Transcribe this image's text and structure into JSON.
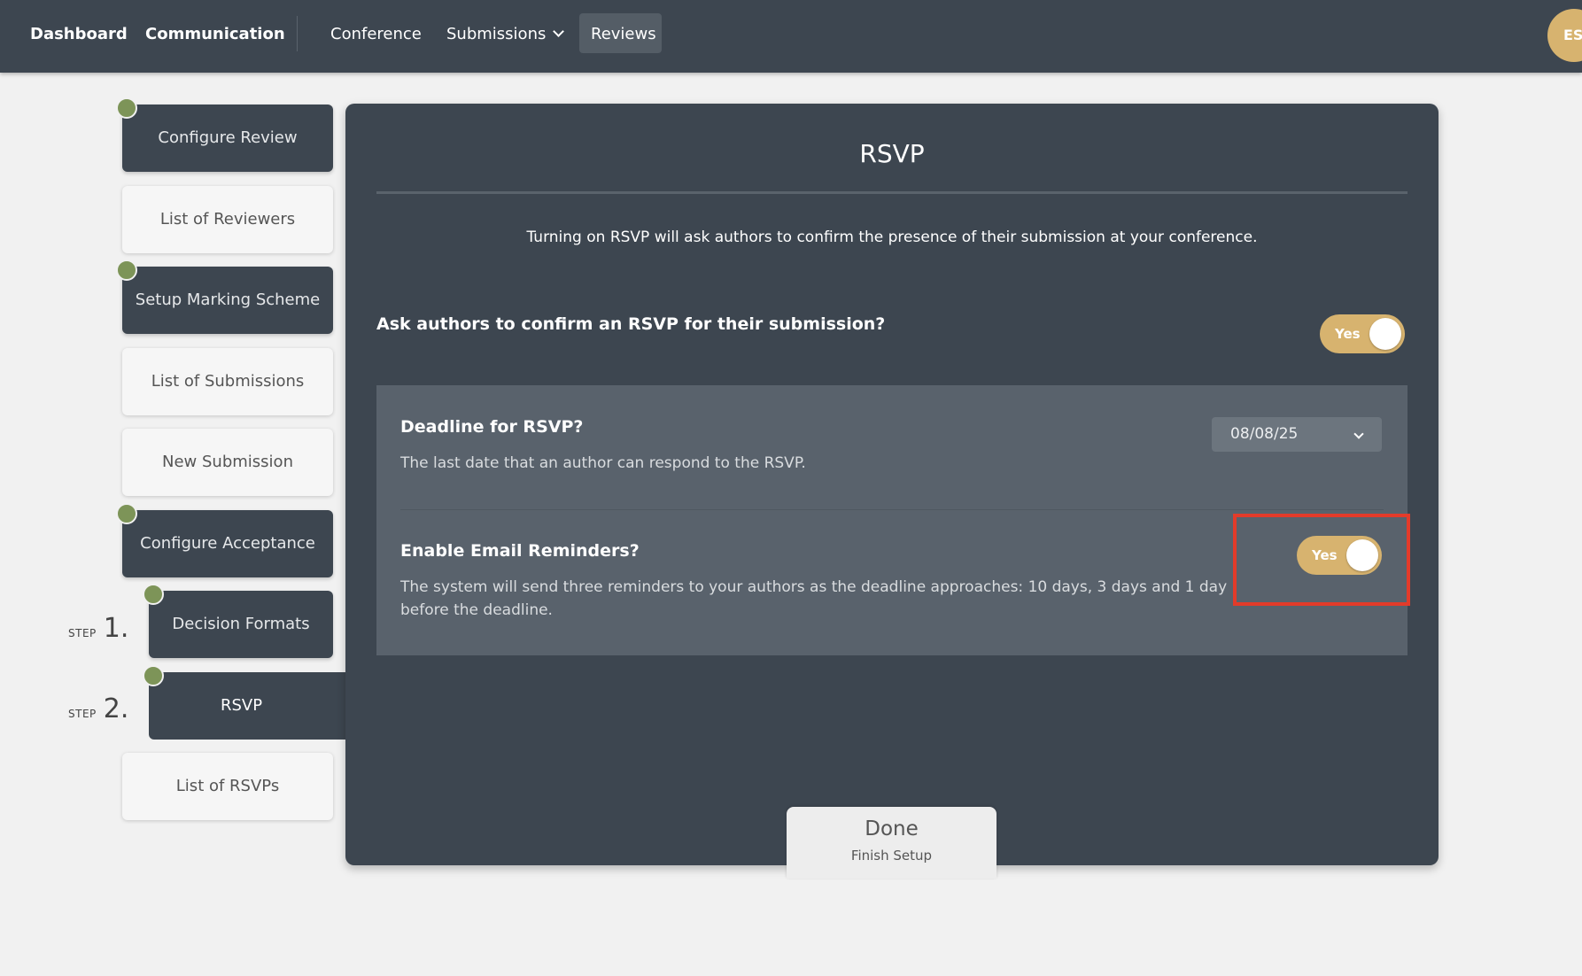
{
  "nav": {
    "dashboard": "Dashboard",
    "communication": "Communication",
    "conference": "Conference",
    "submissions": "Submissions",
    "reviews": "Reviews",
    "avatar_initials": "ES"
  },
  "steps": {
    "configure_review": "Configure Review",
    "list_of_reviewers": "List of Reviewers",
    "setup_marking_scheme": "Setup Marking Scheme",
    "list_of_submissions": "List of Submissions",
    "new_submission": "New Submission",
    "configure_acceptance": "Configure Acceptance",
    "decision_formats": "Decision Formats",
    "rsvp": "RSVP",
    "list_of_rsvps": "List of RSVPs",
    "step_word": "STEP",
    "step1_num": "1.",
    "step2_num": "2."
  },
  "panel": {
    "title": "RSVP",
    "intro": "Turning on RSVP will ask authors to confirm the presence of their submission at your conference.",
    "ask_question": "Ask authors to confirm an RSVP for their submission?",
    "ask_toggle_label": "Yes",
    "deadline_title": "Deadline for RSVP?",
    "deadline_desc": "The last date that an author can respond to the RSVP.",
    "deadline_value": "08/08/25",
    "reminders_title": "Enable Email Reminders?",
    "reminders_desc": "The system will send three reminders to your authors as the deadline approaches: 10 days, 3 days and 1 day before the deadline.",
    "reminders_toggle_label": "Yes"
  },
  "footer": {
    "done_label": "Done",
    "done_sub": "Finish Setup"
  },
  "colors": {
    "nav_bg": "#3d4650",
    "accent_gold": "#d7b36f",
    "step_dot_green": "#7d9458",
    "highlight_red": "#e33b2a"
  }
}
